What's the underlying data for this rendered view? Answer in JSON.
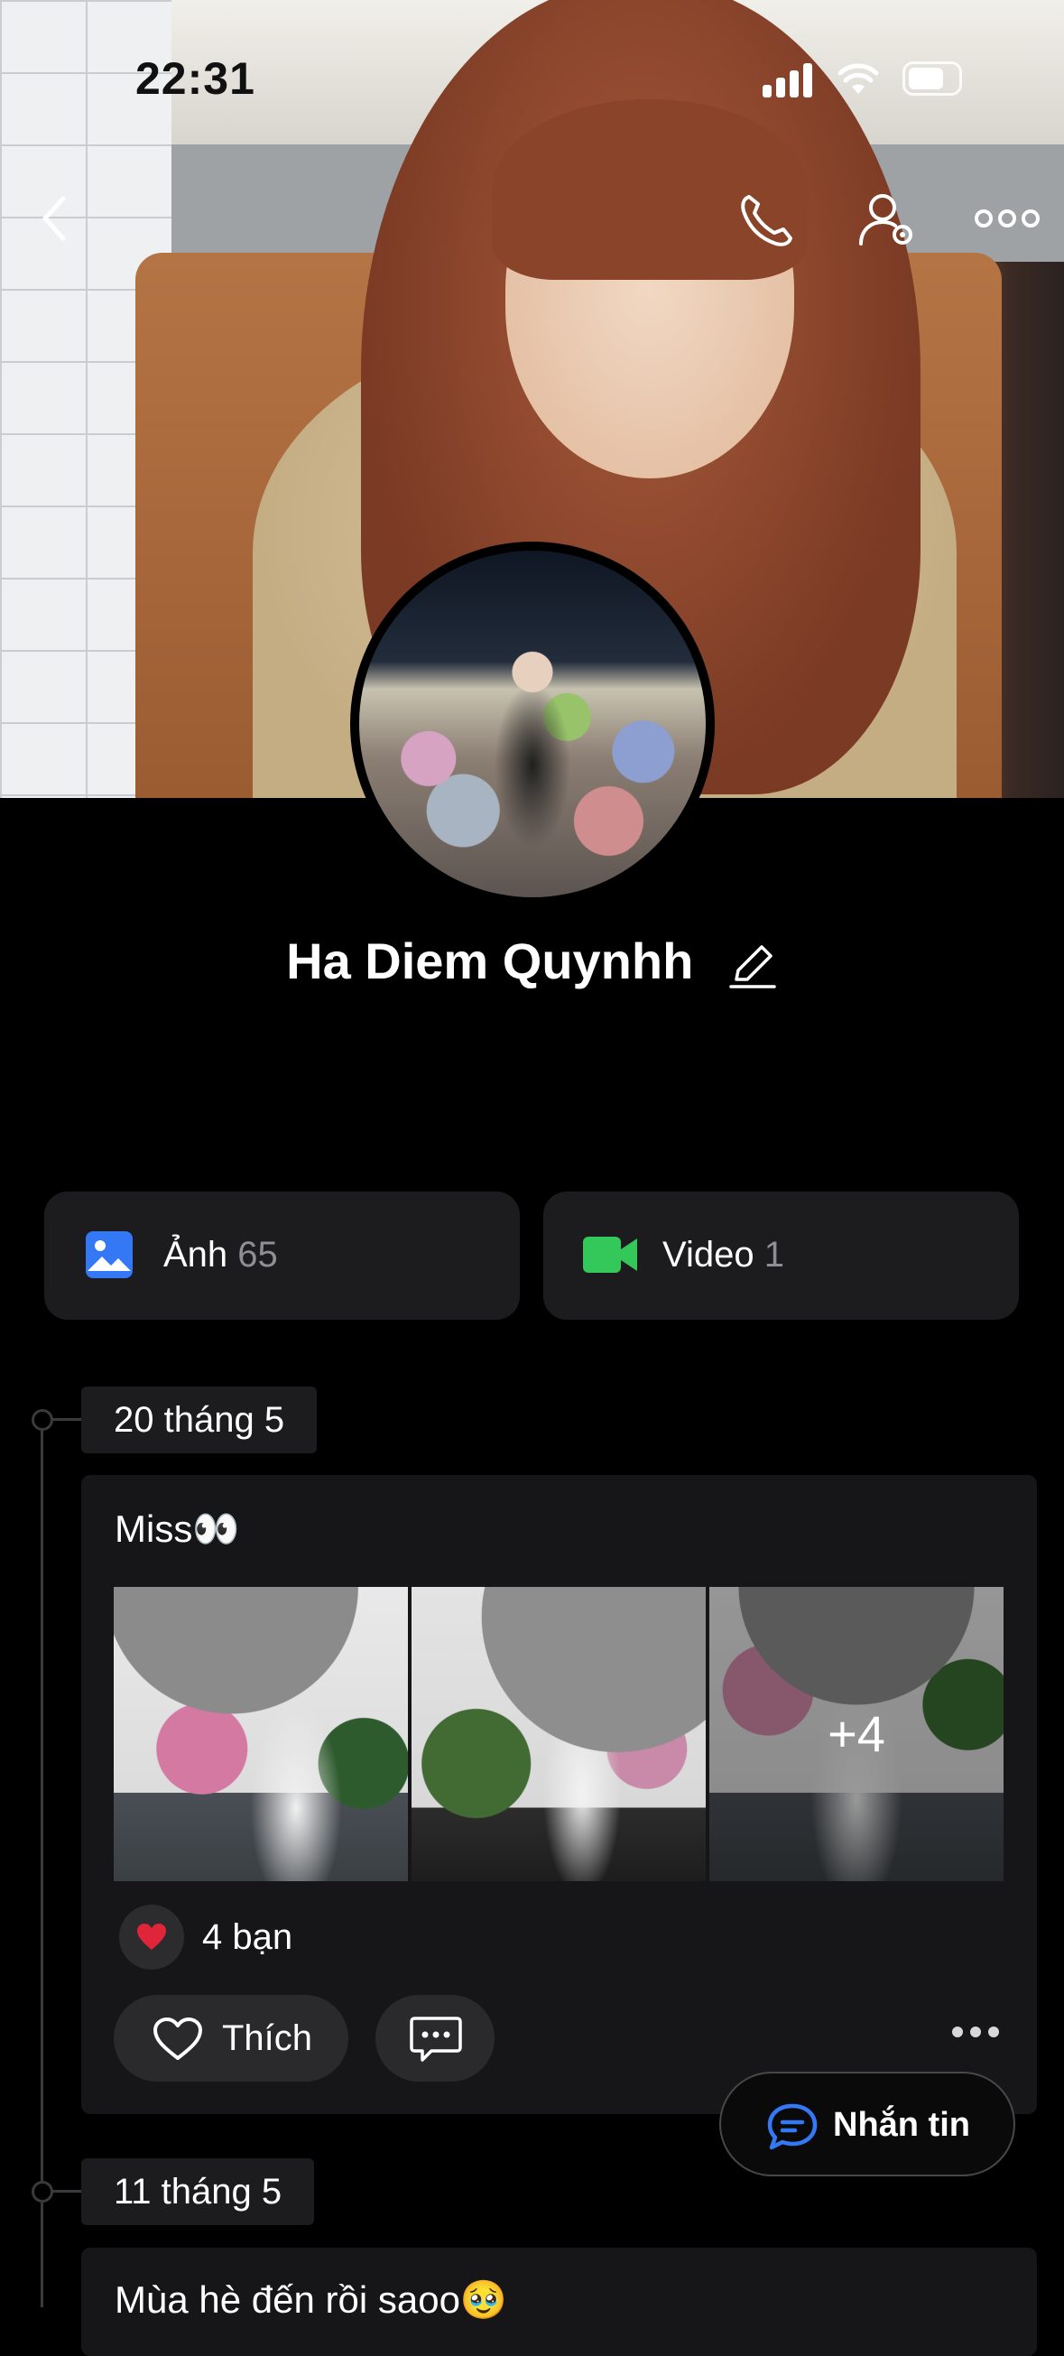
{
  "status_bar": {
    "time": "22:31"
  },
  "profile": {
    "name": "Ha Diem Quynhh"
  },
  "media": {
    "photos": {
      "label": "Ảnh",
      "count": "65",
      "icon": "photo-icon",
      "color": "#3478f6"
    },
    "videos": {
      "label": "Video",
      "count": "1",
      "icon": "video-camera-icon",
      "color": "#34c759"
    }
  },
  "posts": [
    {
      "date": "20 tháng 5",
      "text": "Miss👀",
      "more_photos": "+4",
      "reactions": "4 bạn",
      "like_label": "Thích"
    },
    {
      "date": "11 tháng 5",
      "text": "Mùa hè đến rồi saoo🥹"
    }
  ],
  "message_button": {
    "label": "Nhắn tin"
  },
  "colors": {
    "accent": "#3478f6",
    "card": "#1c1c1e",
    "background": "#000000",
    "like_heart": "#e0243a"
  }
}
